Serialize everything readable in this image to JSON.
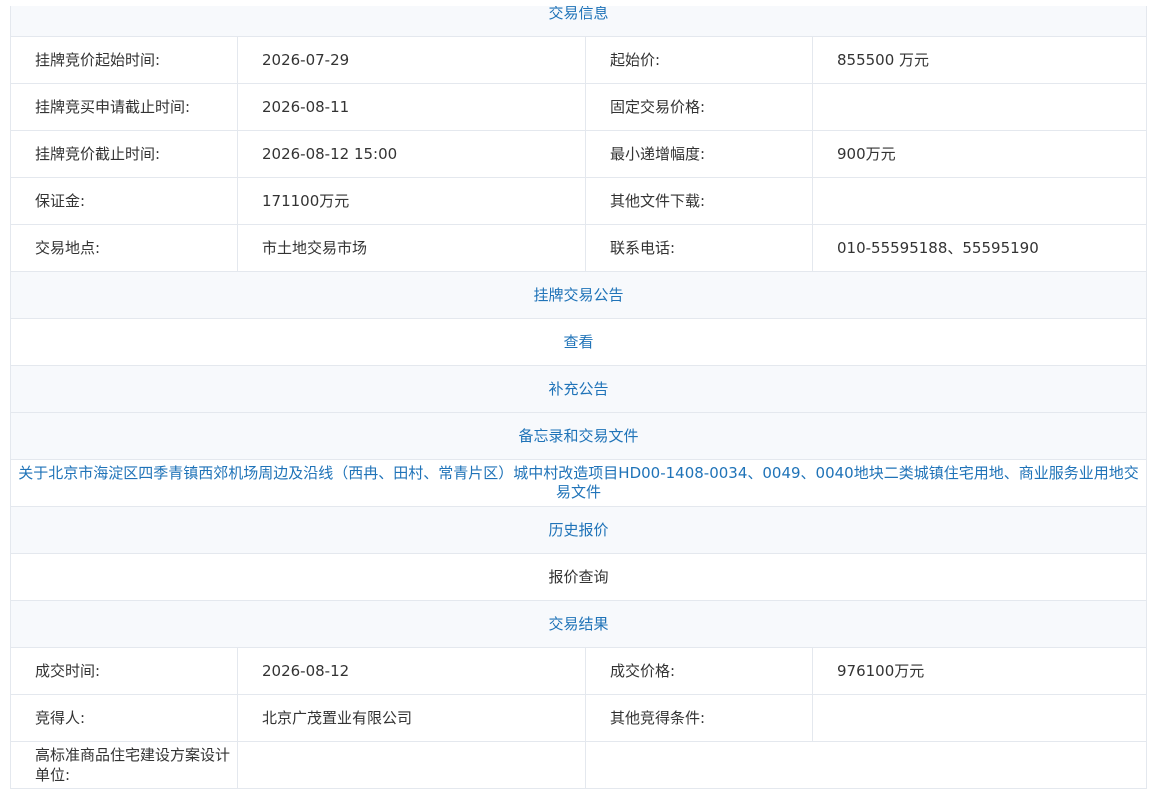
{
  "sections": {
    "trade_info": "交易信息",
    "listing_announcement": "挂牌交易公告",
    "supplementary_announcement": "补充公告",
    "memo_docs": "备忘录和交易文件",
    "price_history": "历史报价",
    "trade_result": "交易结果"
  },
  "trade_info": {
    "rows": [
      {
        "label1": "挂牌竞价起始时间:",
        "value1": "2026-07-29",
        "label2": "起始价:",
        "value2": "855500 万元"
      },
      {
        "label1": "挂牌竞买申请截止时间:",
        "value1": "2026-08-11",
        "label2": "固定交易价格:",
        "value2": ""
      },
      {
        "label1": "挂牌竞价截止时间:",
        "value1": "2026-08-12 15:00",
        "label2": "最小递增幅度:",
        "value2": "900万元"
      },
      {
        "label1": "保证金:",
        "value1": "171100万元",
        "label2": "其他文件下载:",
        "value2": ""
      },
      {
        "label1": "交易地点:",
        "value1": "市土地交易市场",
        "label2": "联系电话:",
        "value2": "010-55595188、55595190"
      }
    ]
  },
  "links": {
    "view": "查看",
    "memo_doc_title": "关于北京市海淀区四季青镇西郊机场周边及沿线（西冉、田村、常青片区）城中村改造项目HD00-1408-0034、0049、0040地块二类城镇住宅用地、商业服务业用地交易文件",
    "price_query": "报价查询"
  },
  "trade_result": {
    "rows": [
      {
        "label1": "成交时间:",
        "value1": "2026-08-12",
        "label2": "成交价格:",
        "value2": "976100万元"
      },
      {
        "label1": "竞得人:",
        "value1": "北京广茂置业有限公司",
        "label2": "其他竞得条件:",
        "value2": ""
      }
    ],
    "design_unit_label": "高标准商品住宅建设方案设计单位:",
    "design_unit_value": ""
  }
}
